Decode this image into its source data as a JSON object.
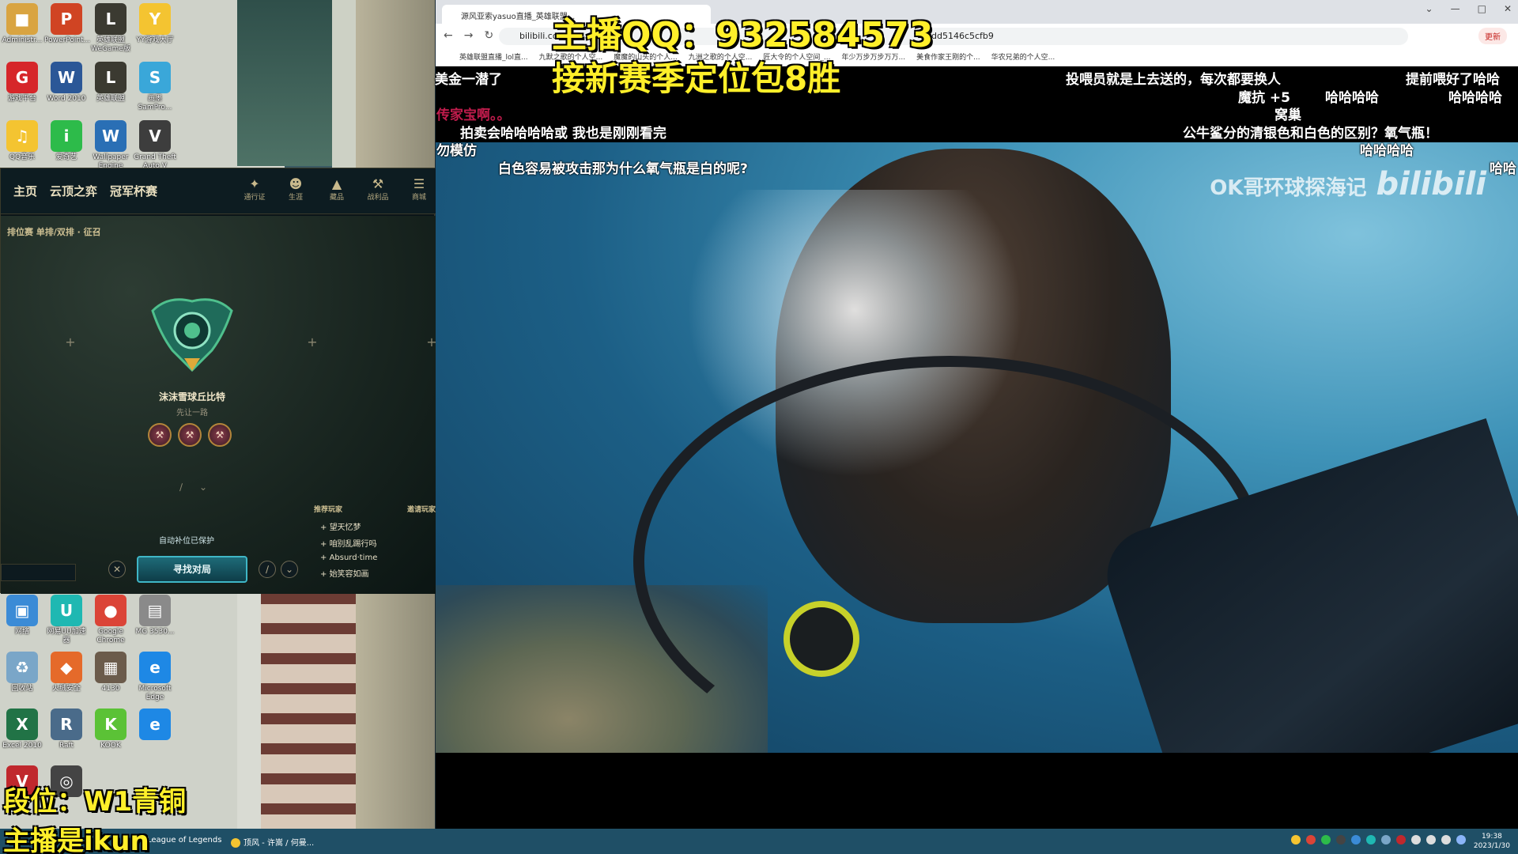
{
  "desktop": {
    "icons_top": [
      {
        "label": "Administr...",
        "color": "#d9a441",
        "glyph": "■"
      },
      {
        "label": "PowerPoint...",
        "color": "#d04423",
        "glyph": "P"
      },
      {
        "label": "英雄联盟 WeGame版",
        "color": "#3b3a31",
        "glyph": "L"
      },
      {
        "label": "YY游戏大厅",
        "color": "#f4c431",
        "glyph": "Y"
      },
      {
        "label": "游戏平台",
        "color": "#d6262a",
        "glyph": "G"
      },
      {
        "label": "Word 2010",
        "color": "#2b5797",
        "glyph": "W"
      },
      {
        "label": "英雄联盟",
        "color": "#3b3a31",
        "glyph": "L"
      },
      {
        "label": "画墨SamPro...",
        "color": "#3aa7d9",
        "glyph": "S"
      },
      {
        "label": "QQ音乐",
        "color": "#f4c431",
        "glyph": "♫"
      },
      {
        "label": "爱奇艺",
        "color": "#2dbb4a",
        "glyph": "i"
      },
      {
        "label": "Wallpaper Engine",
        "color": "#2a6fb5",
        "glyph": "W"
      },
      {
        "label": "Grand Theft Auto V",
        "color": "#3d3d3d",
        "glyph": "V"
      }
    ],
    "icons_bottom": [
      {
        "label": "网络",
        "color": "#3b8bd6",
        "glyph": "▣"
      },
      {
        "label": "网易UU加速器",
        "color": "#1fb8b2",
        "glyph": "U"
      },
      {
        "label": "Google Chrome",
        "color": "#db4437",
        "glyph": "●"
      },
      {
        "label": "MG 3530...",
        "color": "#8a8a8a",
        "glyph": "▤"
      },
      {
        "label": "回收站",
        "color": "#7aa6c8",
        "glyph": "♻"
      },
      {
        "label": "火绒安全",
        "color": "#e56a2a",
        "glyph": "◆"
      },
      {
        "label": "4130",
        "color": "#6b5b4b",
        "glyph": "▦"
      },
      {
        "label": "Microsoft Edge",
        "color": "#1e88e5",
        "glyph": "e"
      },
      {
        "label": "Excel 2010",
        "color": "#217346",
        "glyph": "X"
      },
      {
        "label": "Raft",
        "color": "#4a6b8a",
        "glyph": "R"
      },
      {
        "label": "KOOK",
        "color": "#5bc236",
        "glyph": "K"
      },
      {
        "label": "",
        "color": "#1e88e5",
        "glyph": "e"
      },
      {
        "label": "",
        "color": "#c0282d",
        "glyph": "V"
      },
      {
        "label": "",
        "color": "#444444",
        "glyph": "◎"
      }
    ]
  },
  "lol": {
    "tabs": [
      "主页",
      "云顶之弈",
      "冠军杯赛"
    ],
    "nav_icons": [
      {
        "label": "通行证",
        "icon": "pass-icon",
        "glyph": "✦"
      },
      {
        "label": "生涯",
        "icon": "profile-icon",
        "glyph": "☻"
      },
      {
        "label": "藏品",
        "icon": "collection-icon",
        "glyph": "▲"
      },
      {
        "label": "战利品",
        "icon": "loot-icon",
        "glyph": "⚒"
      },
      {
        "label": "商城",
        "icon": "store-icon",
        "glyph": "☰"
      }
    ],
    "mode": "排位赛 单排/双排 · 征召",
    "summoner_name": "沫沫雪球丘比特",
    "position_note": "先让一路",
    "auto_fill": "自动补位已保护",
    "find_match": "寻找对局",
    "friends_header_left": "推荐玩家",
    "friends_header_right": "邀请玩家",
    "friends": [
      "望天忆梦",
      "咱别乱踢行吗",
      "Absurd·time",
      "始笑容如画"
    ]
  },
  "browser": {
    "tab_title": "源风亚索yasuo直播_英雄联盟...",
    "url": "bilibili.com",
    "url_tail": "3dd5146c5cfb9",
    "update_label": "更新",
    "bookmarks": [
      "英雄联盟直播_lol直...",
      "九默之歌的个人空...",
      "魔魔的山头的个人...",
      "九洲之歌的个人空...",
      "匠大令的个人空间_...",
      "年少万步万步万万...",
      "美食作家王刚的个...",
      "华农兄弟的个人空..."
    ]
  },
  "video": {
    "watermark": "OK哥环球探海记",
    "watermark_logo": "bilibili"
  },
  "danmaku": [
    {
      "text": "美金一潜了",
      "pink": false
    },
    {
      "text": "投喂员就是上去送的，每次都要换人",
      "pink": false
    },
    {
      "text": "提前喂好了哈哈",
      "pink": false
    },
    {
      "text": "魔抗 +5",
      "pink": false
    },
    {
      "text": "哈哈哈哈",
      "pink": false
    },
    {
      "text": "哈哈哈哈",
      "pink": false
    },
    {
      "text": "窝巢",
      "pink": false
    },
    {
      "text": "传家宝啊。。",
      "pink": true
    },
    {
      "text": "拍卖会哈哈哈哈或  我也是刚刚看完",
      "pink": false
    },
    {
      "text": "公牛鲨分的清银色和白色的区别？氧气瓶！",
      "pink": false
    },
    {
      "text": "勿模仿",
      "pink": false
    },
    {
      "text": "哈哈哈哈",
      "pink": false
    },
    {
      "text": "白色容易被攻击那为什么氧气瓶是白的呢?",
      "pink": false
    },
    {
      "text": "哈哈",
      "pink": false
    }
  ],
  "overlays": {
    "qq": "主播QQ：932584573",
    "promo": "接新赛季定位包8胜",
    "rank": "段位：W1青铜",
    "ikun": "主播是ikun"
  },
  "taskbar": {
    "items": [
      "League of Legends",
      "顶风 - 许嵩 / 何曼..."
    ],
    "time": "19:38",
    "date": "2023/1/30"
  }
}
